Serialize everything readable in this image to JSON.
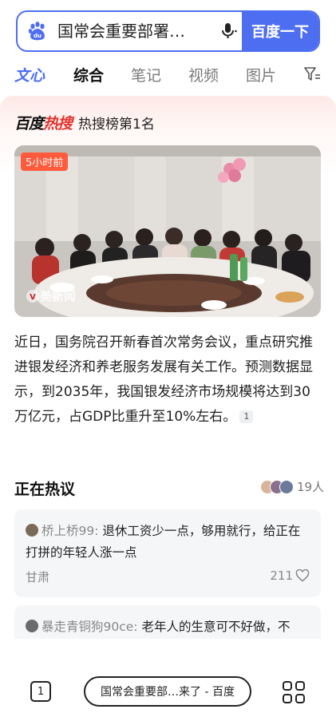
{
  "search": {
    "query": "国常会重要部署…",
    "button_label": "百度一下"
  },
  "tabs": [
    {
      "label": "文心"
    },
    {
      "label": "综合"
    },
    {
      "label": "笔记"
    },
    {
      "label": "视频"
    },
    {
      "label": "图片"
    }
  ],
  "hot": {
    "logo_prefix": "百度",
    "logo_hot": "热搜",
    "rank_text": "热搜榜第1名"
  },
  "photo": {
    "time_badge": "5小时前",
    "watermark": "美新闻"
  },
  "summary": {
    "text": "近日，国务院召开新春首次常务会议，重点研究推进银发经济和养老服务发展有关工作。预测数据显示，到2035年，我国银发经济市场规模将达到30万亿元，占GDP比重升至10%左右。",
    "ref": "1"
  },
  "discussion": {
    "title": "正在热议",
    "participants": "19人",
    "comments": [
      {
        "user": "桥上桥99:",
        "text": "退休工资少一点，够用就行，给正在打拼的年轻人涨一点",
        "location": "甘肃",
        "likes": "211"
      },
      {
        "user": "暴走青铜狗90ce:",
        "text": "老年人的生意可不好做，不"
      }
    ]
  },
  "bottom": {
    "page_count": "1",
    "title": "国常会重要部…来了 - 百度"
  },
  "colors": {
    "brand_blue": "#4e6ef2",
    "hot_red": "#e3342f",
    "badge_orange": "#ff5a3c"
  }
}
